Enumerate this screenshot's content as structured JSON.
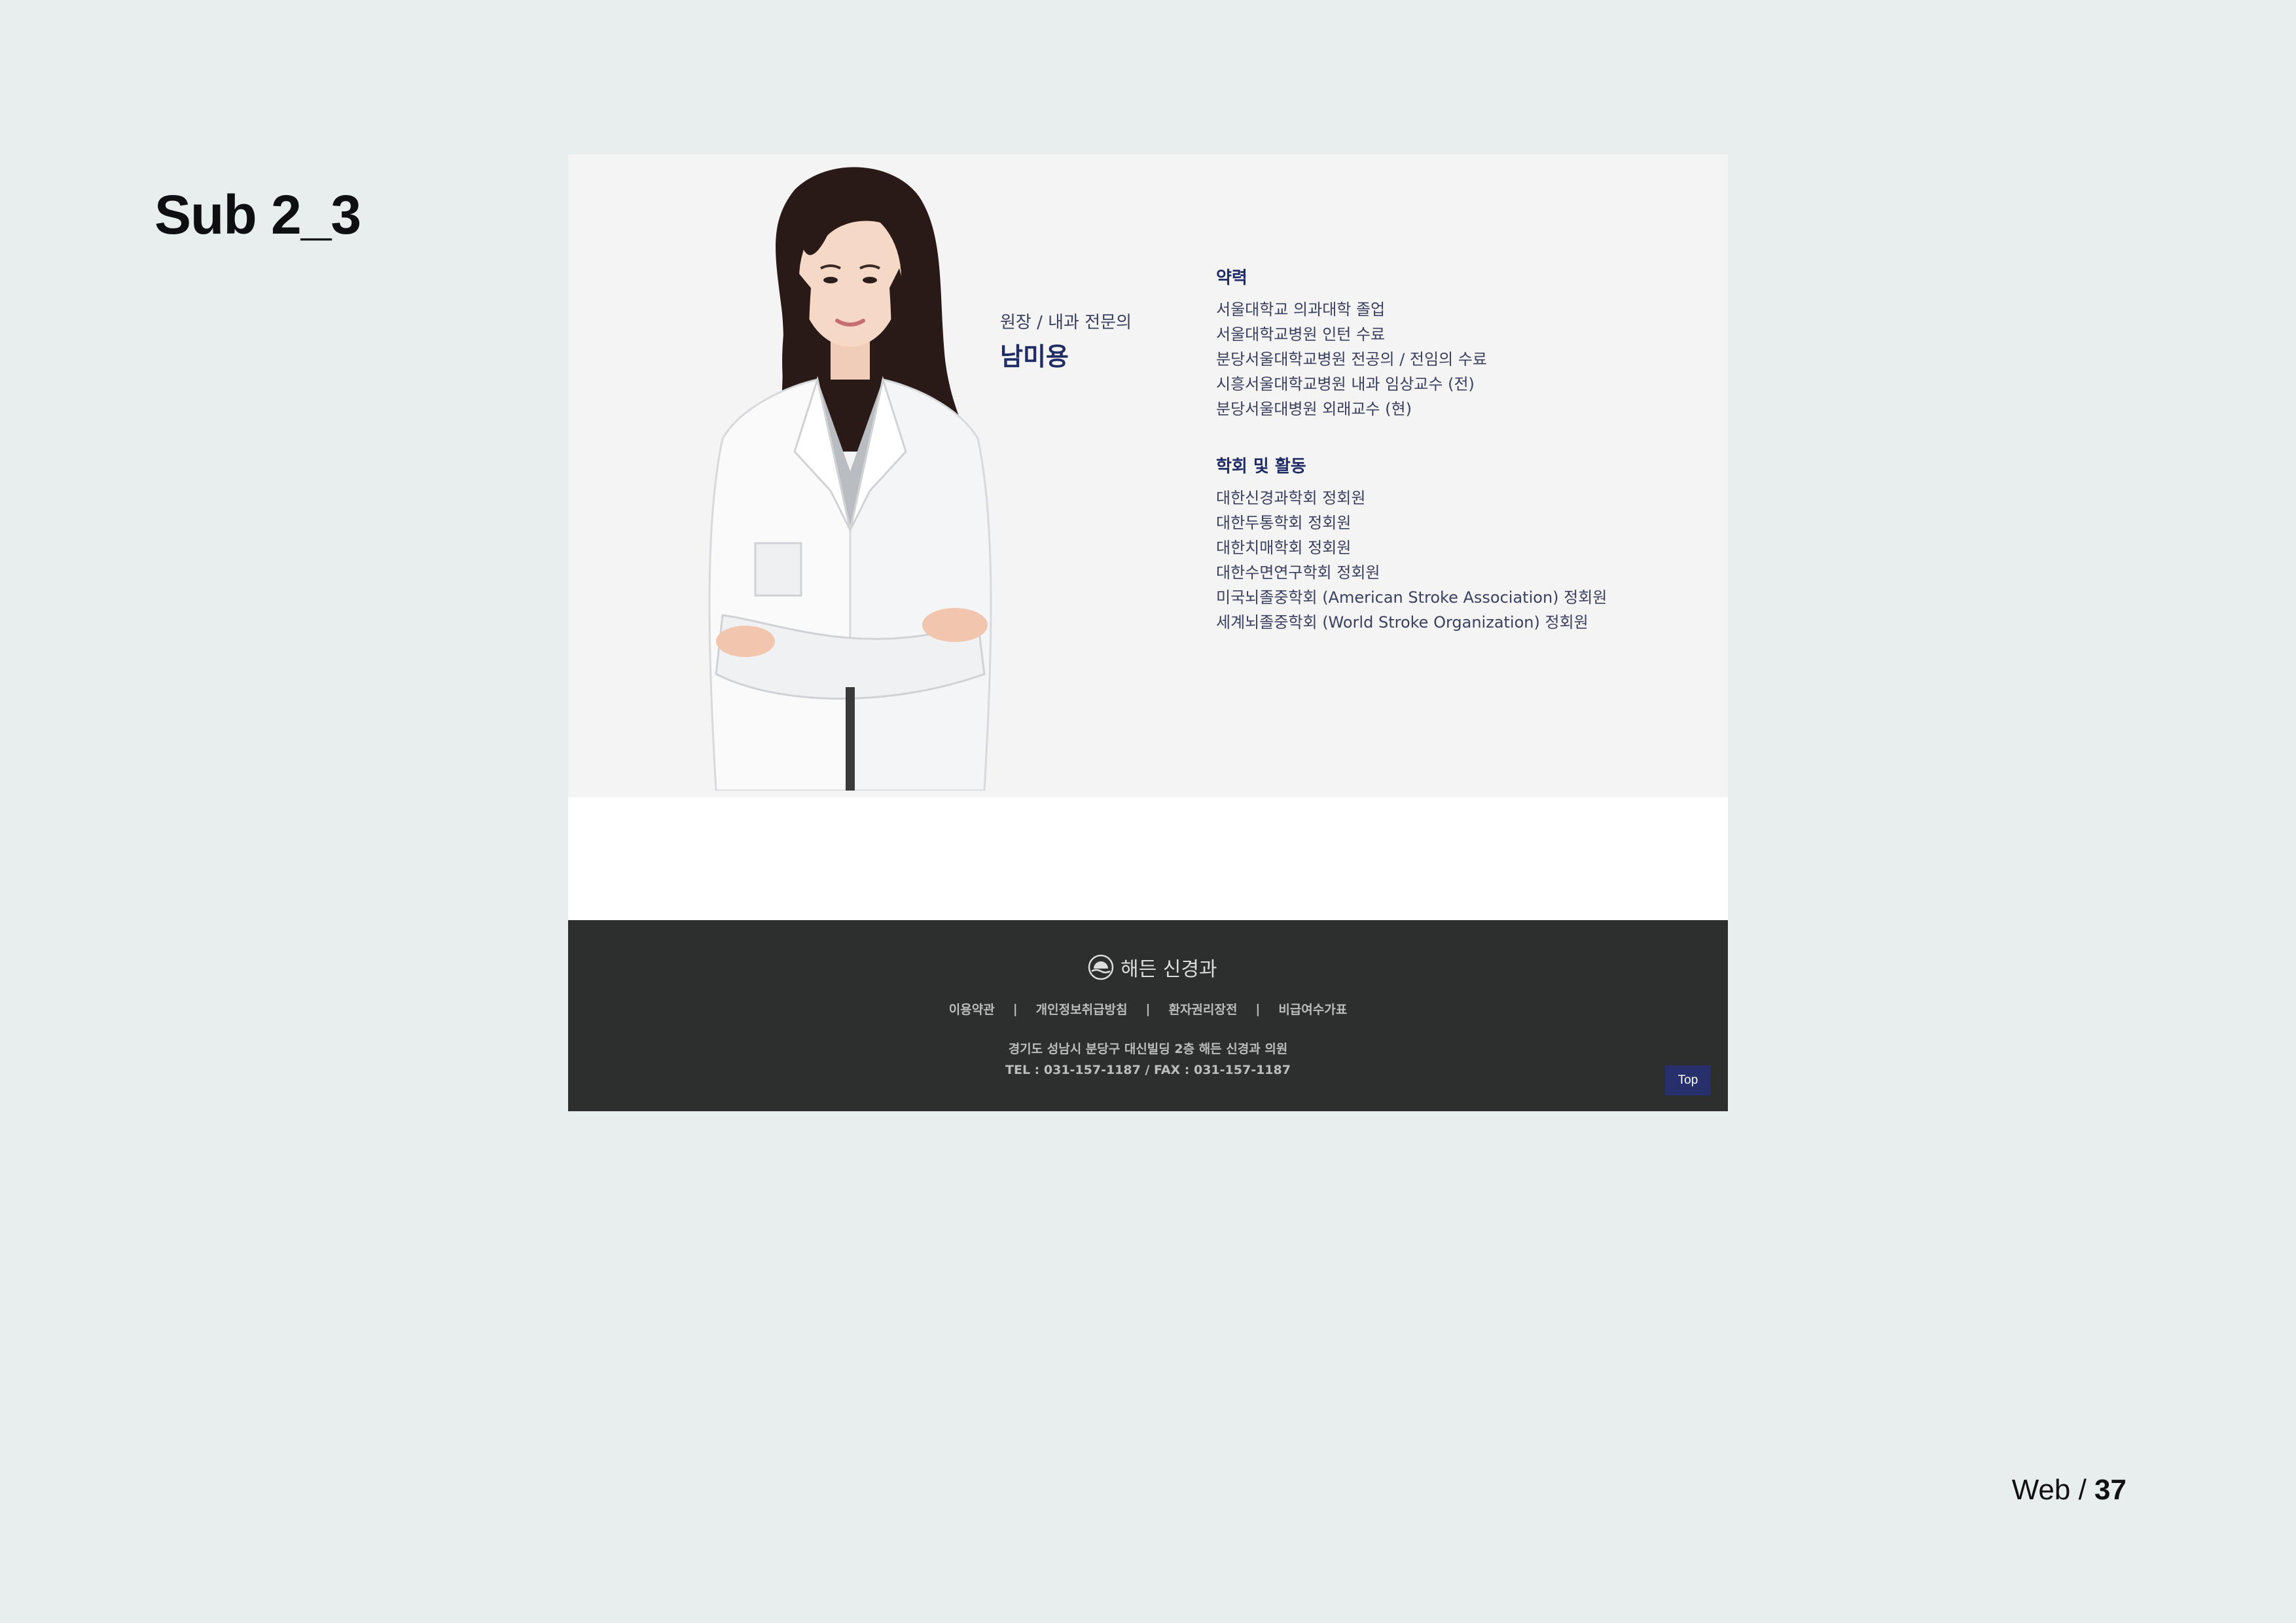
{
  "slide": {
    "title": "Sub 2_3",
    "page_prefix": "Web / ",
    "page_number": "37"
  },
  "profile": {
    "role": "원장 / 내과 전문의",
    "name": "남미용"
  },
  "career": {
    "heading": "약력",
    "items": [
      "서울대학교 의과대학 졸업",
      "서울대학교병원 인턴 수료",
      "분당서울대학교병원 전공의 / 전임의 수료",
      "시흥서울대학교병원 내과 임상교수 (전)",
      "분당서울대병원 외래교수 (현)"
    ]
  },
  "activities": {
    "heading": "학회 및 활동",
    "items": [
      "대한신경과학회 정회원",
      "대한두통학회 정회원",
      "대한치매학회 정회원",
      "대한수면연구학회 정회원",
      "미국뇌졸중학회 (American Stroke Association) 정회원",
      "세계뇌졸중학회 (World Stroke Organization) 정회원"
    ]
  },
  "footer": {
    "logo_text": "해든 신경과",
    "links": [
      "이용약관",
      "개인정보취급방침",
      "환자권리장전",
      "비급여수가표"
    ],
    "separator": "|",
    "address": "경기도 성남시 분당구 대신빌딩 2층 해든 신경과 의원",
    "tel": "TEL : 031-157-1187 / FAX : 031-157-1187",
    "top_label": "Top"
  },
  "colors": {
    "background": "#e8eded",
    "accent": "#1f2c66",
    "footer_bg": "#2d2f2e",
    "top_button": "#27306a"
  },
  "icons": {
    "logo": "sun-over-water-logo-icon"
  }
}
